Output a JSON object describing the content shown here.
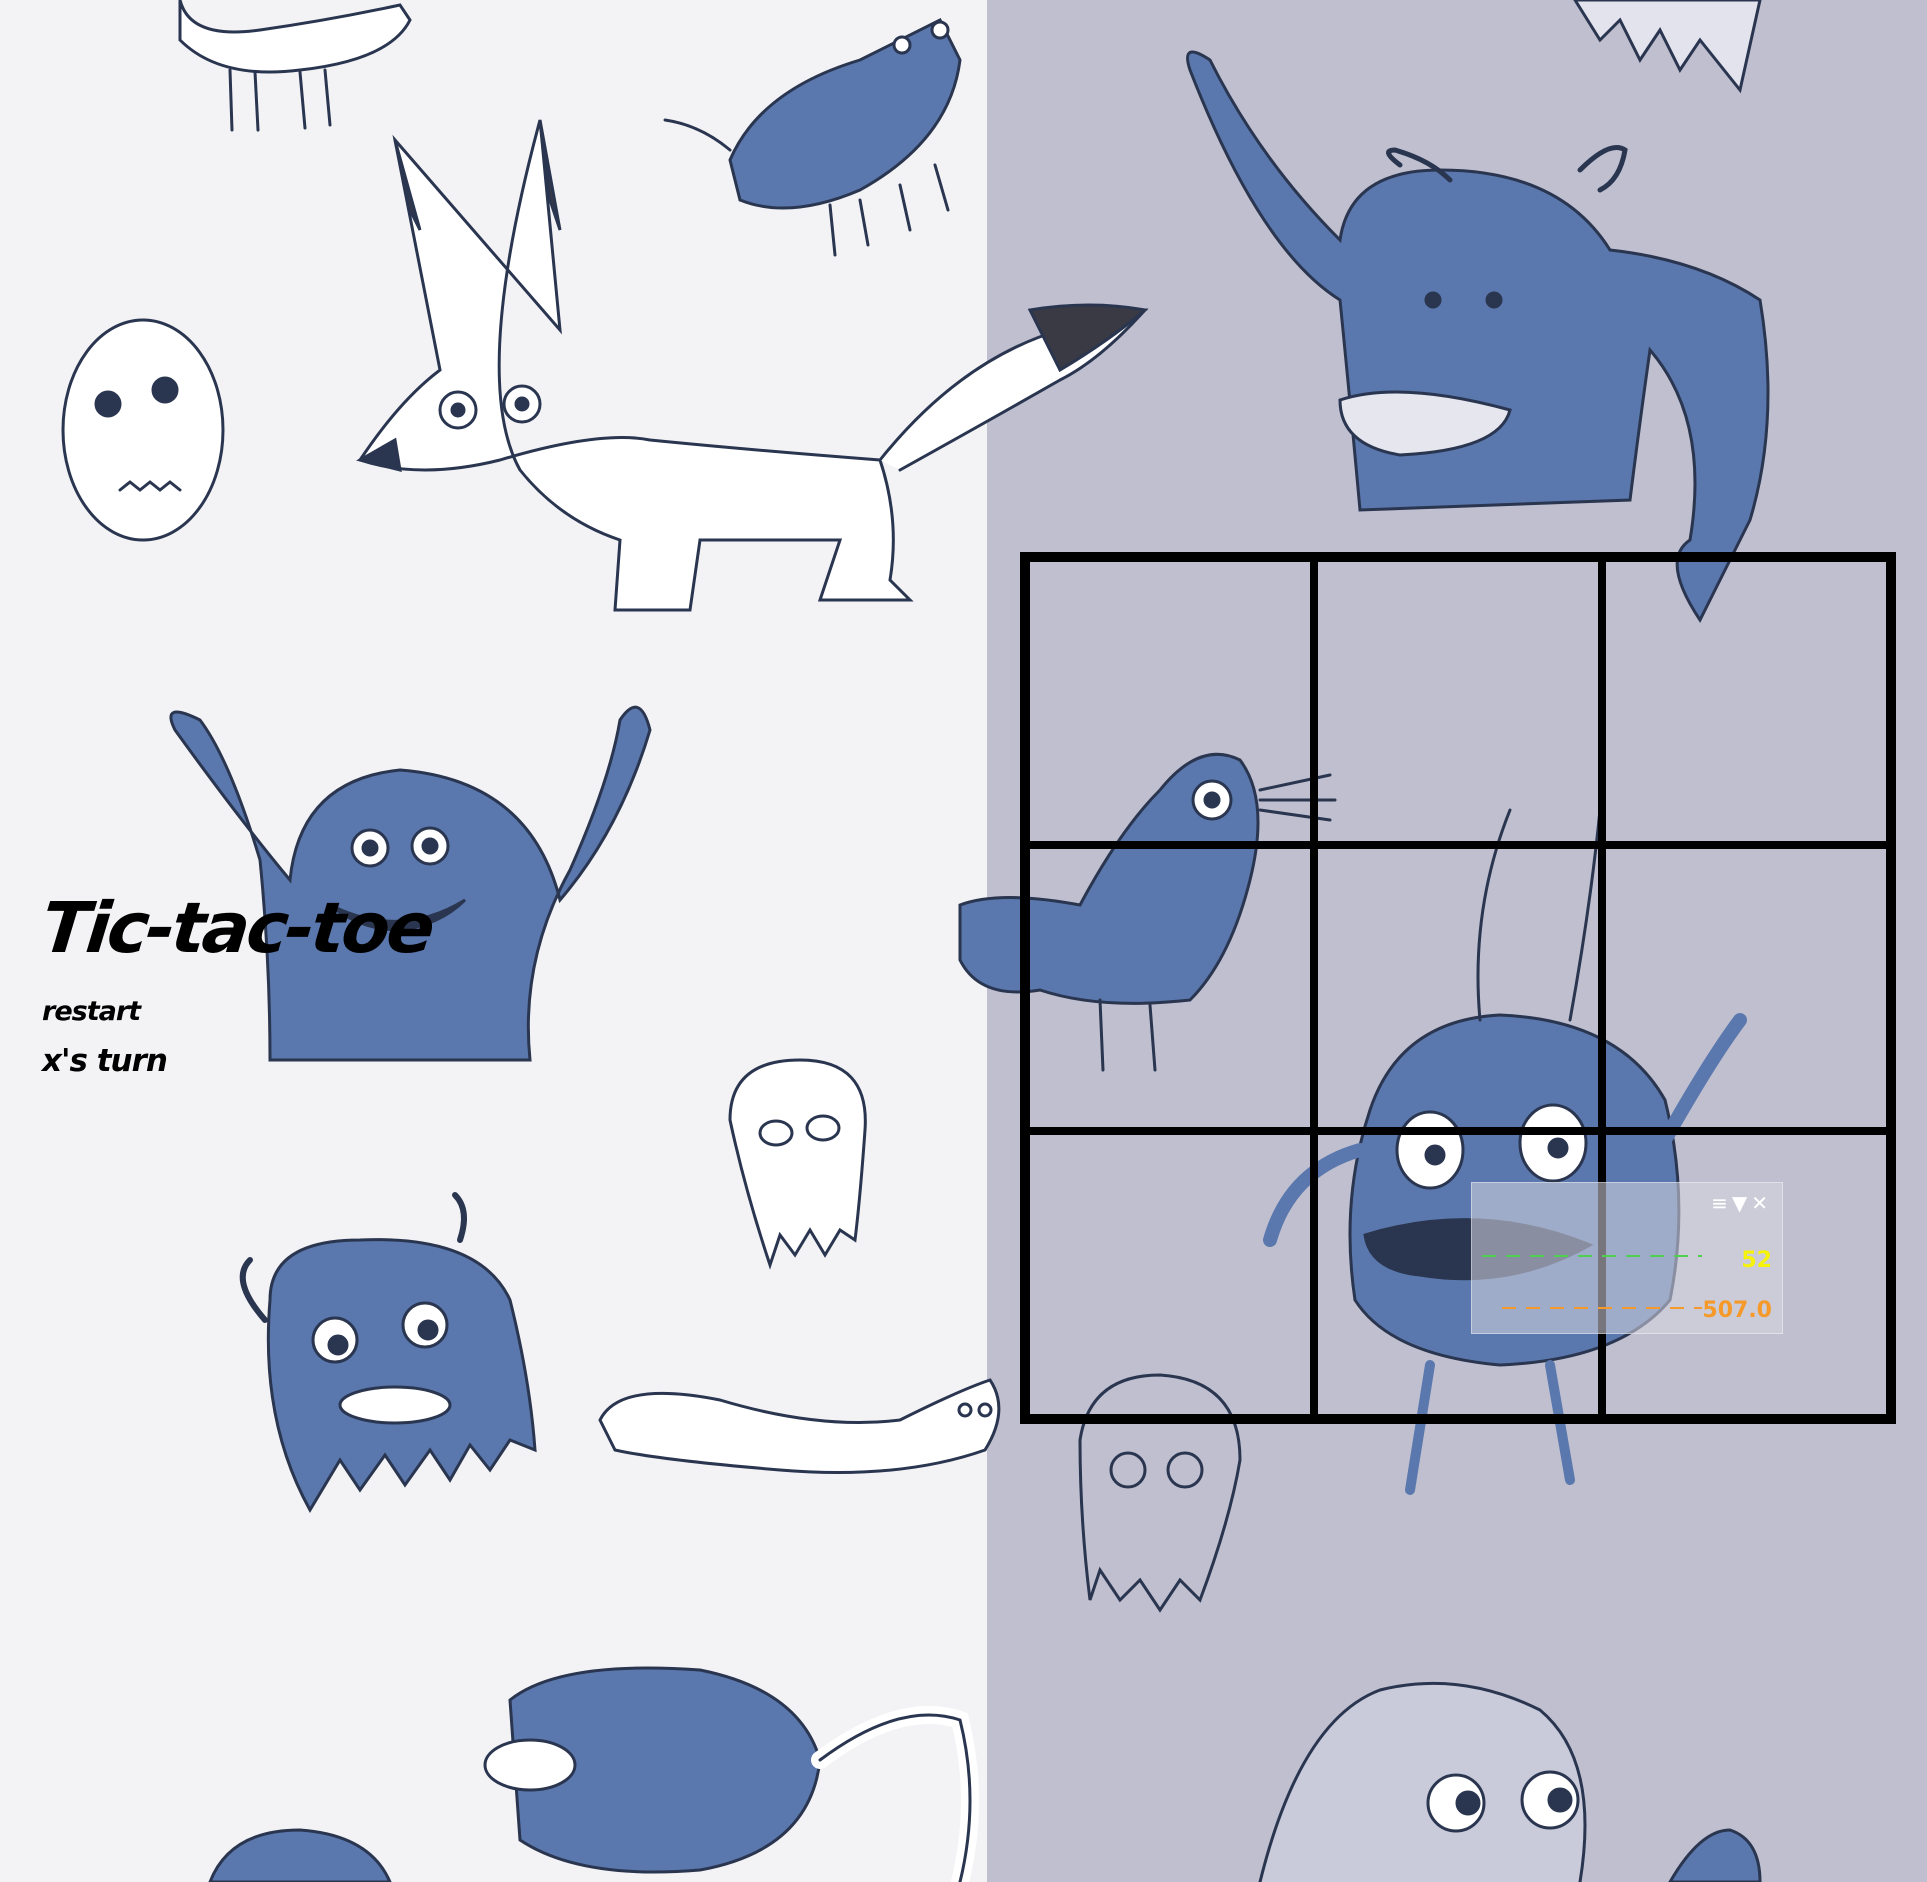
{
  "game": {
    "title": "Tic-tac-toe",
    "restart_label": "restart",
    "turn_status": "x's turn",
    "board": [
      "",
      "",
      "",
      "",
      "",
      "",
      "",
      "",
      ""
    ]
  },
  "stats_panel": {
    "menu_icon": "menu-icon",
    "collapse_icon": "triangle-down-icon",
    "close_icon": "close-icon",
    "fps_value": "52",
    "memory_value": "507.0",
    "fps_color": "#f5f30a",
    "memory_color": "#f59a2a"
  },
  "colors": {
    "left_background": "#f3f3f6",
    "right_background": "#bfbfcf",
    "monster_blue": "#5a78ad",
    "grid_lines": "#000000"
  }
}
